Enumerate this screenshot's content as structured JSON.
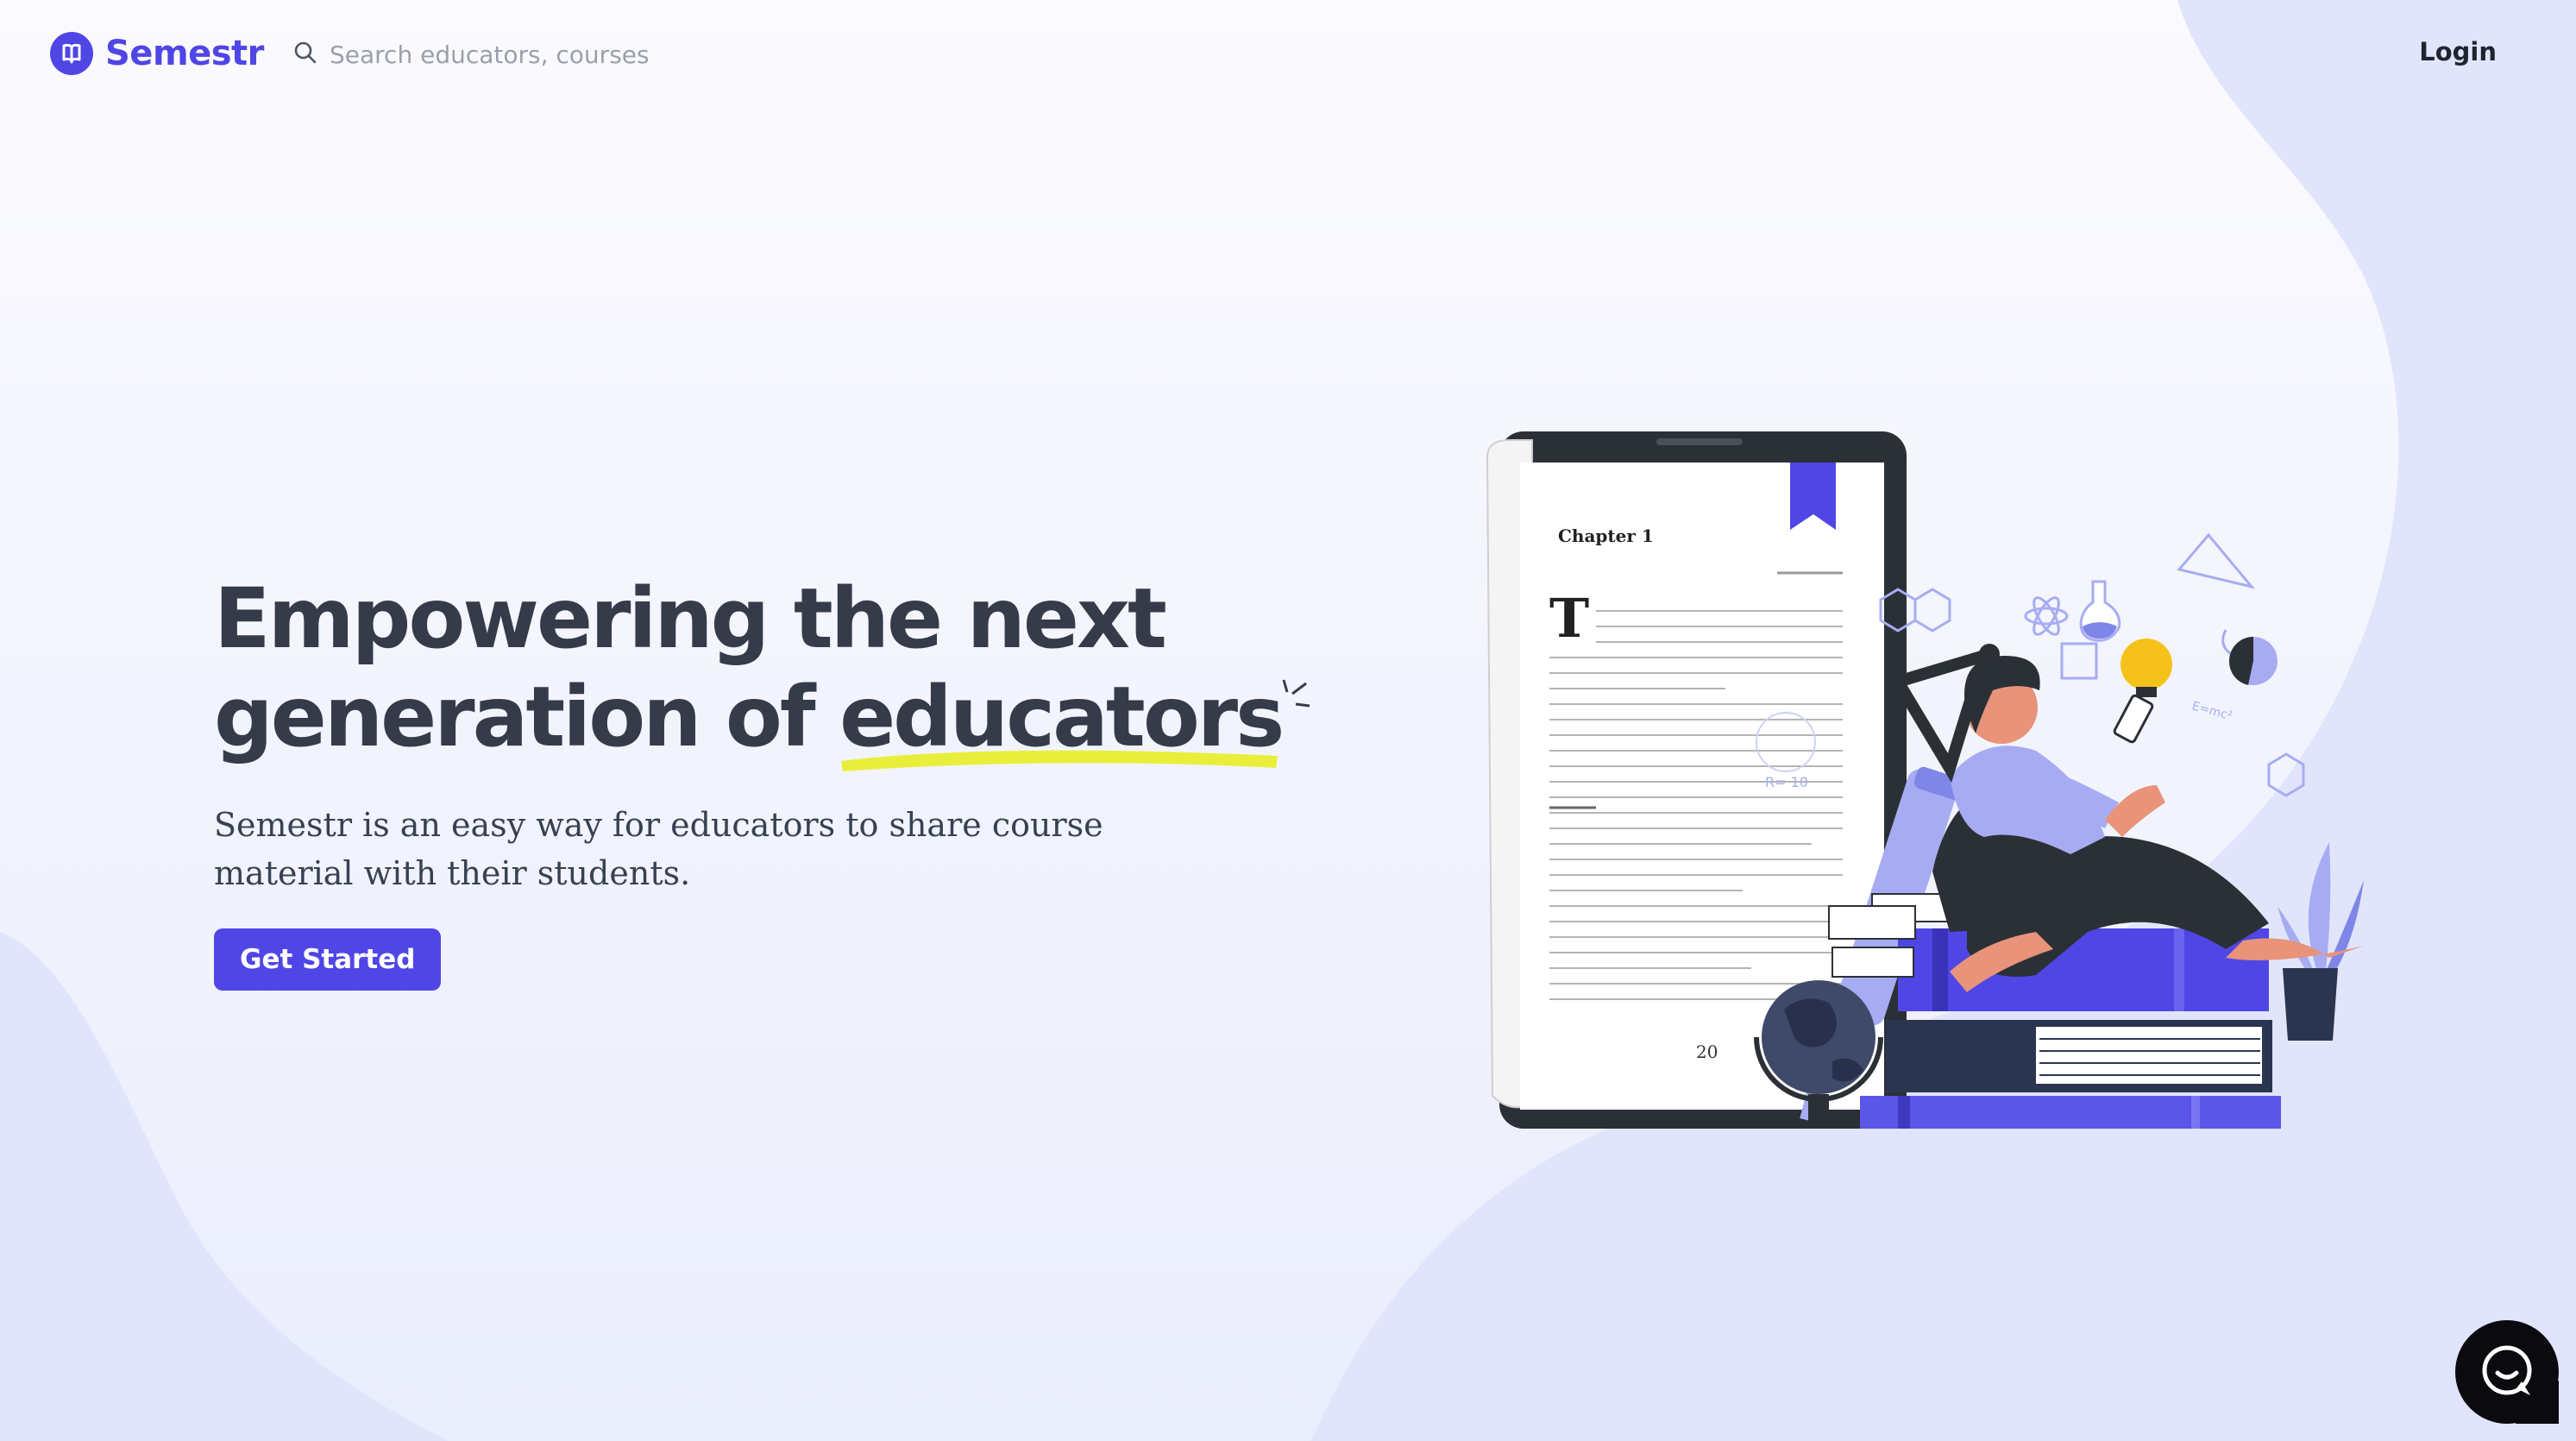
{
  "brand": {
    "name": "Semestr",
    "accent": "#4f46e5"
  },
  "search": {
    "placeholder": "Search educators, courses",
    "value": ""
  },
  "nav": {
    "login_label": "Login"
  },
  "hero": {
    "headline_line1": "Empowering the next",
    "headline_line2_prefix": "generation of ",
    "headline_highlight": "educators",
    "subtitle": "Semestr is an easy way for educators to share course material with their students.",
    "cta_label": "Get Started"
  },
  "illustration": {
    "book_chapter": "Chapter 1",
    "book_dropcap": "T",
    "book_page_number": "20",
    "formula_note": "R= 10",
    "formula_note_2": "E=mc²"
  },
  "colors": {
    "highlight": "#e9ee3a",
    "text_dark": "#363b4a",
    "background": "#f7f8fd",
    "wave": "#e3e6fb"
  },
  "icons": [
    "logo-book-icon",
    "search-icon",
    "chat-icon"
  ]
}
